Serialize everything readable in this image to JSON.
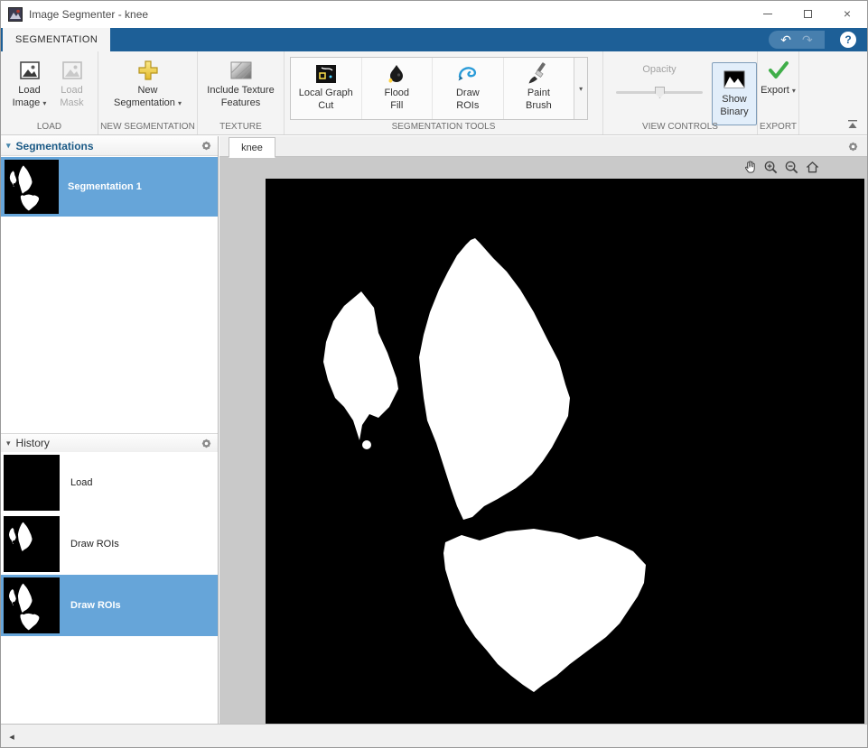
{
  "colors": {
    "toolstrip_blue": "#1d5f97",
    "selection_blue": "#66a5d9",
    "export_green": "#3fae49",
    "new_segmentation_yellow": "#f0cf44",
    "mask_foreground": "#ffffff",
    "mask_background": "#000000"
  },
  "window": {
    "title": "Image Segmenter - knee"
  },
  "icons": {
    "dropdown": "▾",
    "undo": "↶",
    "redo": "↷",
    "help": "?",
    "close": "×",
    "panel_collapse": "▾",
    "scroll_left": "◂"
  },
  "ribbon_tab": "SEGMENTATION",
  "ribbon": {
    "load": {
      "section": "LOAD",
      "load_image": "Load Image",
      "load_mask": "Load Mask"
    },
    "new_seg": {
      "section": "NEW SEGMENTATION",
      "button": "New Segmentation"
    },
    "texture": {
      "section": "TEXTURE",
      "button": "Include Texture Features"
    },
    "tools": {
      "section": "SEGMENTATION TOOLS",
      "local_graph_cut": "Local Graph Cut",
      "flood_fill": "Flood Fill",
      "draw_rois": "Draw ROIs",
      "paint_brush": "Paint Brush"
    },
    "view": {
      "section": "VIEW CONTROLS",
      "opacity_label": "Opacity",
      "show_binary": "Show Binary"
    },
    "export": {
      "section": "EXPORT",
      "button": "Export"
    }
  },
  "segmentations_panel": {
    "title": "Segmentations",
    "items": [
      {
        "label": "Segmentation 1"
      }
    ]
  },
  "history_panel": {
    "title": "History",
    "items": [
      {
        "label": "Load"
      },
      {
        "label": "Draw ROIs"
      },
      {
        "label": "Draw ROIs"
      }
    ]
  },
  "document": {
    "tab": "knee"
  }
}
